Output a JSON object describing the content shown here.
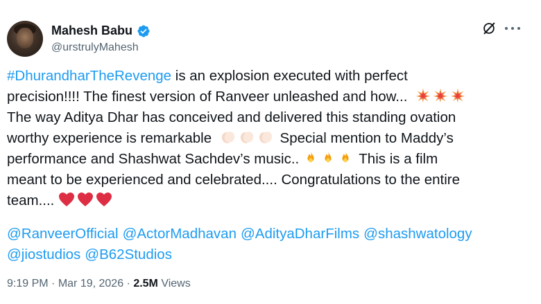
{
  "author": {
    "name": "Mahesh Babu",
    "handle": "@urstrulyMahesh"
  },
  "icons": {
    "verified": "verified-badge-icon",
    "grok": "grok-icon",
    "more": "more-options-icon"
  },
  "colors": {
    "link": "#1d9bf0",
    "verified": "#1d9bf0",
    "text": "#0f1419",
    "muted": "#536471"
  },
  "tweet": {
    "l1_tag": "#DhurandharTheRevenge",
    "l1_text": " is an explosion executed with perfect",
    "l2": "precision!!!! The finest version of Ranveer unleashed and how...",
    "l3": "The way Aditya Dhar has conceived and delivered this standing ovation",
    "l4a": "worthy experience is remarkable",
    "l4b": " Special mention to Maddy’s",
    "l5a": "performance and Shashwat Sachdev’s music..",
    "l5b": " This is a film",
    "l6": "meant to be experienced and celebrated.... Congratulations to the entire",
    "l7": "team...."
  },
  "mentions": [
    "@RanveerOfficial",
    "@ActorMadhavan",
    "@AdityaDharFilms",
    "@shashwatology",
    "@jiostudios",
    "@B62Studios"
  ],
  "meta": {
    "time": "9:19 PM",
    "sep": " · ",
    "date": "Mar 19, 2026",
    "views_count": "2.5M",
    "views_label": " Views"
  }
}
